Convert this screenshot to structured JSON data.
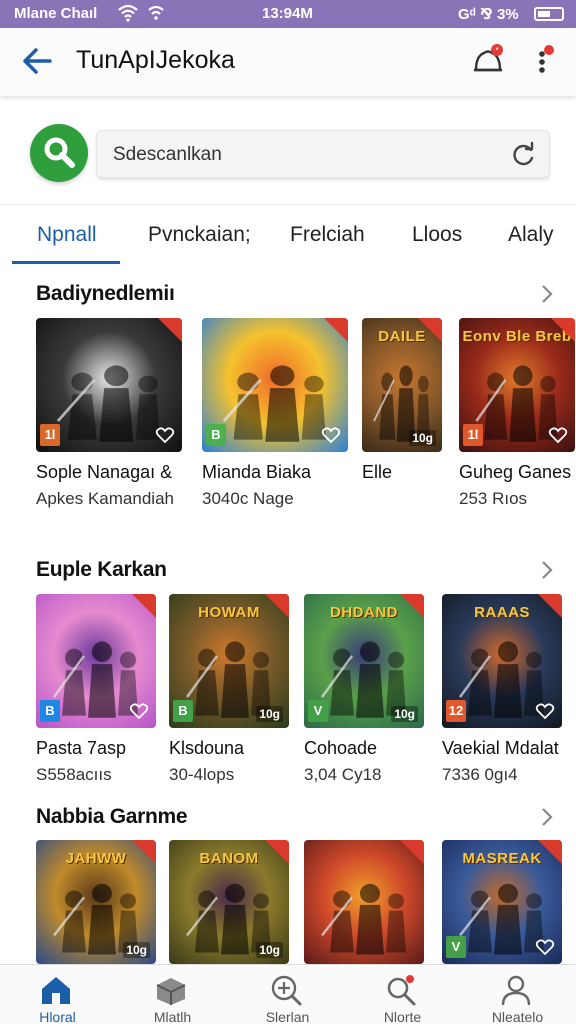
{
  "status_bar": {
    "carrier": "Mlane Chaıl",
    "time": "13:94M",
    "right": "Gᵈ ⅋ 3%"
  },
  "app_bar": {
    "title": "TunApIJekoka"
  },
  "search": {
    "placeholder": "Sdescanlkan"
  },
  "tabs": [
    "Npnall",
    "Pvnckaian;",
    "Frelciah",
    "Lloos",
    "Alaly"
  ],
  "sections": [
    {
      "title": "Badiynedlemiı",
      "items": [
        {
          "name": "Sople Nanagaı &",
          "sub": "Apkes Kamandiah",
          "badge": "1l",
          "badge_color": "#d9692b",
          "corner": "heart",
          "top_banner": "",
          "palette": [
            "#101010",
            "#3a3a3a",
            "#e8e8e8"
          ]
        },
        {
          "name": "Mianda Biaka",
          "sub": "3040c Nage",
          "badge": "B",
          "badge_color": "#4caf50",
          "corner": "heart",
          "top_banner": "",
          "palette": [
            "#2a7fd6",
            "#f5c22e",
            "#f06a2a"
          ]
        },
        {
          "name": "Elle",
          "sub": "",
          "badge": "",
          "badge_color": "",
          "corner": "10g",
          "top_banner": "DAILE",
          "palette": [
            "#3a2a1a",
            "#8a5a2a",
            "#c7772e"
          ]
        },
        {
          "name": "Guheg Ganes",
          "sub": "253 Rıos",
          "badge": "1l",
          "badge_color": "#e0572b",
          "corner": "heart",
          "top_banner": "Eonv Ble Breb",
          "palette": [
            "#3a1010",
            "#9a2a1a",
            "#e07a2a"
          ]
        }
      ]
    },
    {
      "title": "Euple Karkan",
      "items": [
        {
          "name": "Pasta 7asp",
          "sub": "S558acııs",
          "badge": "B",
          "badge_color": "#1e88e5",
          "corner": "heart",
          "top_banner": "",
          "palette": [
            "#b455c8",
            "#e78ad0",
            "#6a3a9a"
          ]
        },
        {
          "name": "Klsdouna",
          "sub": "30-4lops",
          "badge": "B",
          "badge_color": "#43a047",
          "corner": "10g",
          "top_banner": "HOWAM",
          "palette": [
            "#2a3a1a",
            "#7a5a2a",
            "#d07a2a"
          ]
        },
        {
          "name": "Cohoade",
          "sub": "3,04 Cy18",
          "badge": "V",
          "badge_color": "#43a047",
          "corner": "10g",
          "top_banner": "DHDAND",
          "palette": [
            "#2a6a4a",
            "#5aa04a",
            "#3a3a7a"
          ]
        },
        {
          "name": "Vaekial Mdalat",
          "sub": "7336 0gı4",
          "badge": "12",
          "badge_color": "#e0572b",
          "corner": "heart",
          "top_banner": "RAAAS",
          "palette": [
            "#101820",
            "#2a3a5a",
            "#d0682a"
          ]
        }
      ]
    },
    {
      "title": "Nabbia Garnme",
      "items": [
        {
          "name": "",
          "sub": "",
          "badge": "",
          "badge_color": "",
          "corner": "10g",
          "top_banner": "JAHWW",
          "palette": [
            "#2a4a8a",
            "#c08a2a",
            "#5a3a1a"
          ]
        },
        {
          "name": "",
          "sub": "",
          "badge": "",
          "badge_color": "",
          "corner": "10g",
          "top_banner": "BANOM",
          "palette": [
            "#3a3a1a",
            "#8a7a2a",
            "#4a2a4a"
          ]
        },
        {
          "name": "",
          "sub": "",
          "badge": "",
          "badge_color": "",
          "corner": "",
          "top_banner": "",
          "palette": [
            "#5a1a1a",
            "#d04a2a",
            "#f0a02a"
          ]
        },
        {
          "name": "",
          "sub": "",
          "badge": "V",
          "badge_color": "#43a047",
          "corner": "heart",
          "top_banner": "MASREAK",
          "palette": [
            "#1a2a5a",
            "#3a5a9a",
            "#c06a2a"
          ]
        }
      ]
    }
  ],
  "bottom_nav": [
    {
      "label": "Hloral",
      "icon": "home-icon",
      "active": true
    },
    {
      "label": "Mlatlh",
      "icon": "box-icon",
      "active": false
    },
    {
      "label": "Slerlan",
      "icon": "search-zoom-icon",
      "active": false
    },
    {
      "label": "Nlorte",
      "icon": "search-notification-icon",
      "active": false
    },
    {
      "label": "Nleatelo",
      "icon": "profile-icon",
      "active": false
    }
  ],
  "colors": {
    "status_bar": "#8a74b8",
    "accent": "#1b5fa8",
    "search_fab": "#2f9e3c"
  }
}
